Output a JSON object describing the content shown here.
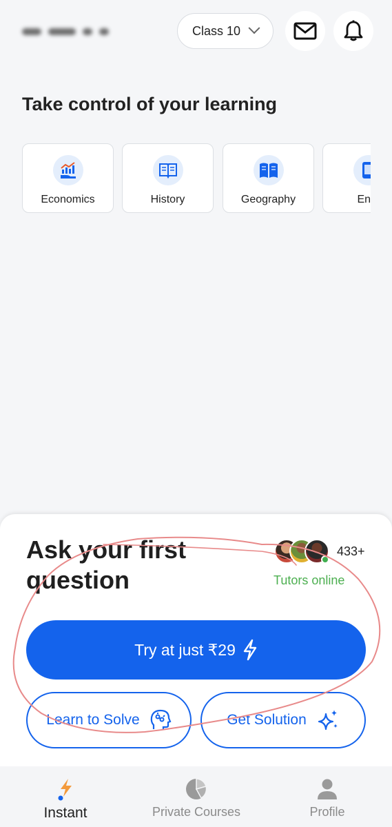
{
  "header": {
    "class_selector": {
      "value": "Class 10",
      "icon": "chevron-down-icon"
    },
    "mail_icon": "mail-icon",
    "notification_icon": "bell-icon"
  },
  "learning": {
    "title": "Take control of your learning",
    "subjects": [
      {
        "label": "Economics",
        "icon": "chart-hand-icon"
      },
      {
        "label": "History",
        "icon": "open-book-icon"
      },
      {
        "label": "Geography",
        "icon": "book-icon"
      },
      {
        "label": "Engl",
        "icon": "tablet-icon"
      }
    ]
  },
  "ask_sheet": {
    "title": "Ask your first question",
    "tutor_count": "433+",
    "tutors_status": "Tutors online",
    "primary_cta": "Try at just ₹29",
    "learn_button": "Learn to Solve",
    "solution_button": "Get Solution"
  },
  "bottom_nav": {
    "items": [
      {
        "label": "Instant",
        "icon": "lightning-icon",
        "active": true
      },
      {
        "label": "Private Courses",
        "icon": "pie-chart-icon",
        "active": false
      },
      {
        "label": "Profile",
        "icon": "person-icon",
        "active": false
      }
    ]
  },
  "colors": {
    "primary": "#1463ec",
    "online": "#4caf50",
    "annotation": "#e88a8a",
    "background": "#f5f6f8"
  }
}
